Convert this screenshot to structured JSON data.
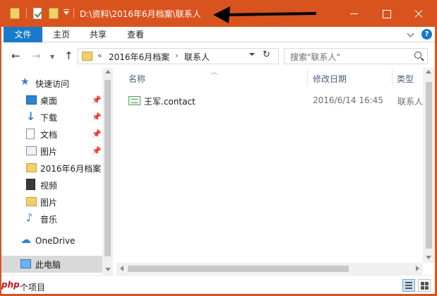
{
  "window": {
    "title": "D:\\资料\\2016年6月档案\\联系人",
    "accent": "#d9531e"
  },
  "ribbon": {
    "file_tab": "文件",
    "tabs": [
      "主页",
      "共享",
      "查看"
    ],
    "help_label": "?"
  },
  "address": {
    "segments": [
      "2016年6月档案",
      "联系人"
    ],
    "chevron": "«",
    "separator": "›"
  },
  "search": {
    "placeholder": "搜索\"联系人\""
  },
  "nav_pane": {
    "items": [
      {
        "label": "快速访问",
        "icon": "star-icon"
      },
      {
        "label": "桌面",
        "icon": "desktop-icon",
        "pinned": true
      },
      {
        "label": "下载",
        "icon": "download-icon",
        "pinned": true
      },
      {
        "label": "文档",
        "icon": "document-icon",
        "pinned": true
      },
      {
        "label": "图片",
        "icon": "picture-icon",
        "pinned": true
      },
      {
        "label": "2016年6月档案",
        "icon": "folder-icon"
      },
      {
        "label": "视频",
        "icon": "video-icon"
      },
      {
        "label": "图片",
        "icon": "folder-icon"
      },
      {
        "label": "音乐",
        "icon": "music-icon"
      },
      {
        "label": "OneDrive",
        "icon": "cloud-icon"
      },
      {
        "label": "此电脑",
        "icon": "computer-icon"
      }
    ]
  },
  "columns": {
    "name": "名称",
    "date": "修改日期",
    "type": "类型"
  },
  "files": [
    {
      "name": "王军.contact",
      "date": "2016/6/14 16:45",
      "type": "联系人文件"
    }
  ],
  "status": {
    "text": "个项目",
    "watermark": "php"
  }
}
